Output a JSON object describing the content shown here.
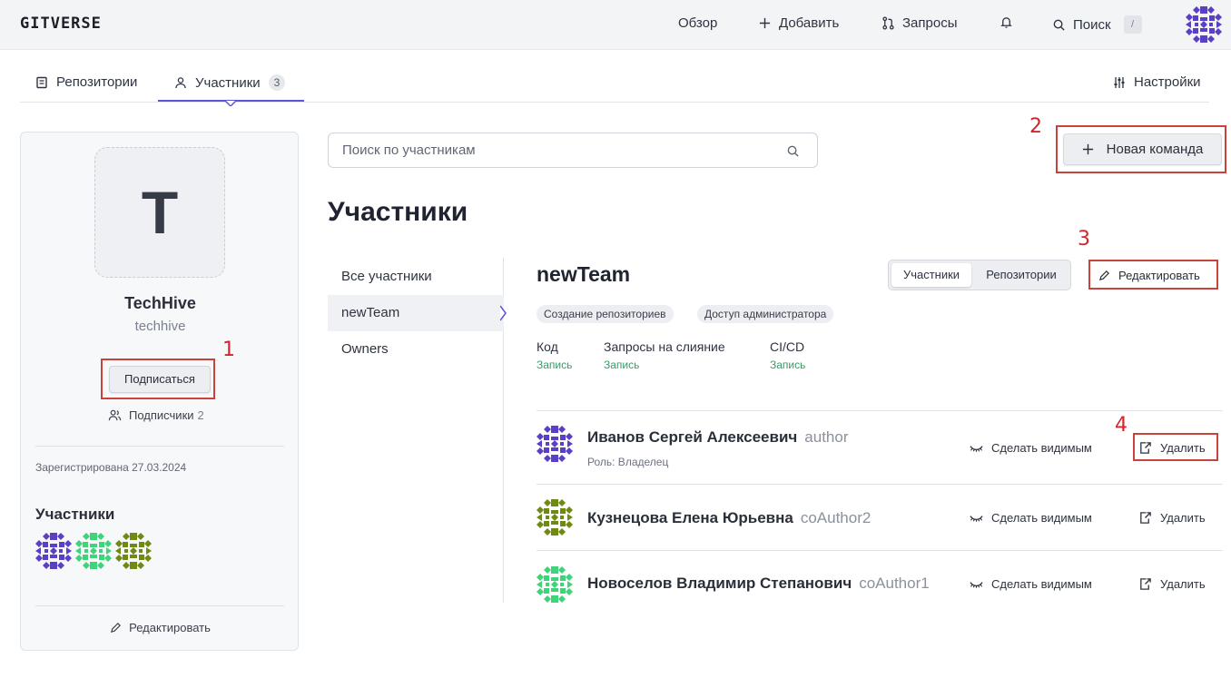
{
  "topbar": {
    "logo": "GITVERSE",
    "nav": {
      "overview": "Обзор",
      "add": "Добавить",
      "requests": "Запросы",
      "search": "Поиск",
      "search_shortcut": "/"
    }
  },
  "tabs": {
    "repositories": "Репозитории",
    "members": "Участники",
    "members_count": "3",
    "settings": "Настройки"
  },
  "profile": {
    "avatar_letter": "T",
    "name": "TechHive",
    "handle": "techhive",
    "subscribe_label": "Подписаться",
    "followers_label": "Подписчики",
    "followers_count": "2",
    "registered": "Зарегистрирована 27.03.2024",
    "members_title": "Участники",
    "edit_label": "Редактировать"
  },
  "annotations": [
    "1",
    "2",
    "3",
    "4"
  ],
  "search": {
    "placeholder": "Поиск по участникам"
  },
  "new_team_label": "Новая команда",
  "page_title": "Участники",
  "team_list": [
    "Все участники",
    "newTeam",
    "Owners"
  ],
  "team": {
    "name": "newTeam",
    "segment": {
      "members": "Участники",
      "repositories": "Репозитории"
    },
    "edit_label": "Редактировать",
    "badges": [
      "Создание репозиториев",
      "Доступ администратора"
    ],
    "permissions": [
      {
        "label": "Код",
        "value": "Запись"
      },
      {
        "label": "Запросы на слияние",
        "value": "Запись"
      },
      {
        "label": "CI/CD",
        "value": "Запись"
      }
    ]
  },
  "members": [
    {
      "name": "Иванов Сергей Алексеевич",
      "login": "author",
      "role": "Роль: Владелец",
      "make_visible": "Сделать видимым",
      "remove": "Удалить",
      "avatar_color": "#5b3fc4"
    },
    {
      "name": "Кузнецова Елена Юрьевна",
      "login": "coAuthor2",
      "role": "",
      "make_visible": "Сделать видимым",
      "remove": "Удалить",
      "avatar_color": "#6f8a12"
    },
    {
      "name": "Новоселов Владимир Степанович",
      "login": "coAuthor1",
      "role": "",
      "make_visible": "Сделать видимым",
      "remove": "Удалить",
      "avatar_color": "#3fd47a"
    }
  ],
  "colors": {
    "accent": "#5b57d6",
    "annotation": "#c9423b",
    "permission_value": "#3a9a6a"
  }
}
